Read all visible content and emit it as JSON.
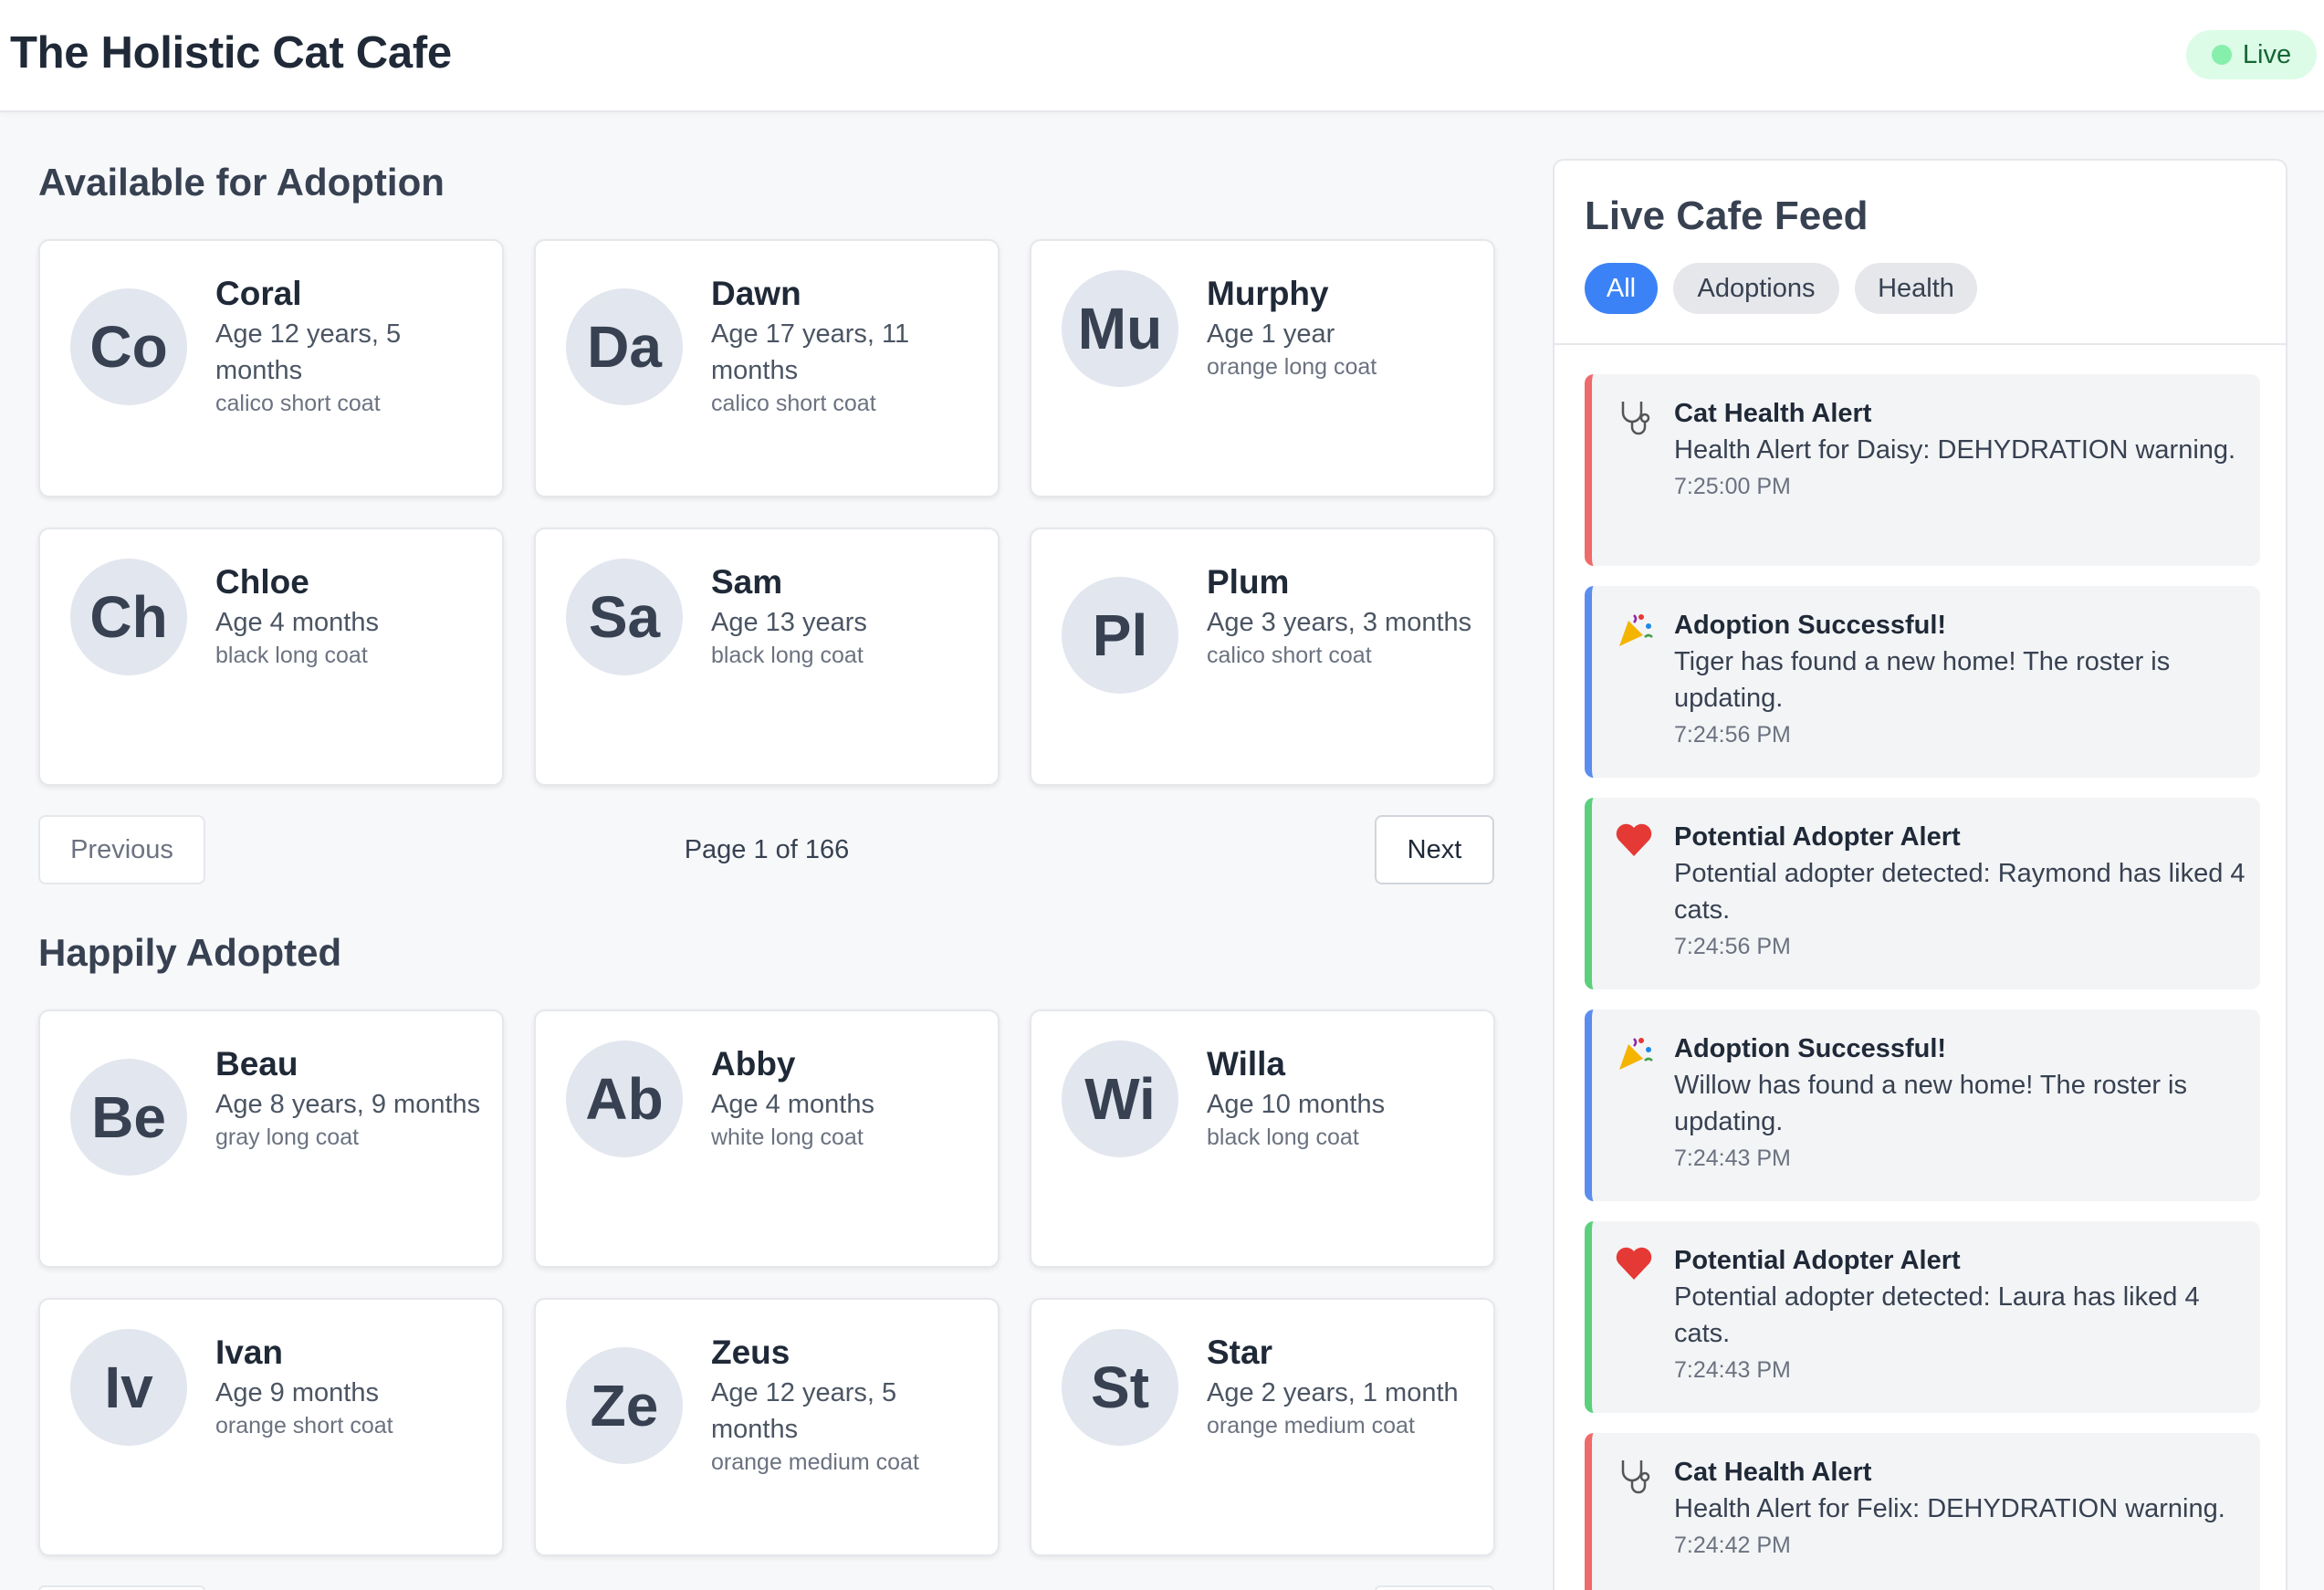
{
  "app": {
    "title": "The Holistic Cat Cafe",
    "status": "Live",
    "status_color": "#86efac"
  },
  "available": {
    "heading": "Available for Adoption",
    "cats": [
      {
        "initials": "Co",
        "name": "Coral",
        "age": "Age 12 years, 5 months",
        "coat": "calico short coat"
      },
      {
        "initials": "Da",
        "name": "Dawn",
        "age": "Age 17 years, 11 months",
        "coat": "calico short coat"
      },
      {
        "initials": "Mu",
        "name": "Murphy",
        "age": "Age 1 year",
        "coat": "orange long coat"
      },
      {
        "initials": "Ch",
        "name": "Chloe",
        "age": "Age 4 months",
        "coat": "black long coat"
      },
      {
        "initials": "Sa",
        "name": "Sam",
        "age": "Age 13 years",
        "coat": "black long coat"
      },
      {
        "initials": "Pl",
        "name": "Plum",
        "age": "Age 3 years, 3 months",
        "coat": "calico short coat"
      }
    ],
    "pager": {
      "prev_label": "Previous",
      "page_text": "Page 1 of 166",
      "next_label": "Next"
    }
  },
  "adopted": {
    "heading": "Happily Adopted",
    "cats": [
      {
        "initials": "Be",
        "name": "Beau",
        "age": "Age 8 years, 9 months",
        "coat": "gray long coat"
      },
      {
        "initials": "Ab",
        "name": "Abby",
        "age": "Age 4 months",
        "coat": "white long coat"
      },
      {
        "initials": "Wi",
        "name": "Willa",
        "age": "Age 10 months",
        "coat": "black long coat"
      },
      {
        "initials": "Iv",
        "name": "Ivan",
        "age": "Age 9 months",
        "coat": "orange short coat"
      },
      {
        "initials": "Ze",
        "name": "Zeus",
        "age": "Age 12 years, 5 months",
        "coat": "orange medium coat"
      },
      {
        "initials": "St",
        "name": "Star",
        "age": "Age 2 years, 1 month",
        "coat": "orange medium coat"
      }
    ]
  },
  "feed": {
    "title": "Live Cafe Feed",
    "filters": [
      {
        "label": "All",
        "active": true
      },
      {
        "label": "Adoptions",
        "active": false
      },
      {
        "label": "Health",
        "active": false
      }
    ],
    "items": [
      {
        "kind": "health",
        "icon": "stethoscope-icon",
        "title": "Cat Health Alert",
        "message": "Health Alert for Daisy: DEHYDRATION warning.",
        "time": "7:25:00 PM"
      },
      {
        "kind": "adoption",
        "icon": "party-popper-icon",
        "title": "Adoption Successful!",
        "message": "Tiger has found a new home! The roster is updating.",
        "time": "7:24:56 PM"
      },
      {
        "kind": "adopter",
        "icon": "heart-icon",
        "title": "Potential Adopter Alert",
        "message": "Potential adopter detected: Raymond has liked 4 cats.",
        "time": "7:24:56 PM"
      },
      {
        "kind": "adoption",
        "icon": "party-popper-icon",
        "title": "Adoption Successful!",
        "message": "Willow has found a new home! The roster is updating.",
        "time": "7:24:43 PM"
      },
      {
        "kind": "adopter",
        "icon": "heart-icon",
        "title": "Potential Adopter Alert",
        "message": "Potential adopter detected: Laura has liked 4 cats.",
        "time": "7:24:43 PM"
      },
      {
        "kind": "health",
        "icon": "stethoscope-icon",
        "title": "Cat Health Alert",
        "message": "Health Alert for Felix: DEHYDRATION warning.",
        "time": "7:24:42 PM"
      }
    ]
  },
  "colors": {
    "health": "#ef6a6a",
    "adoption": "#5b8def",
    "adopter": "#5ccf7d",
    "accent": "#3b82f6"
  }
}
